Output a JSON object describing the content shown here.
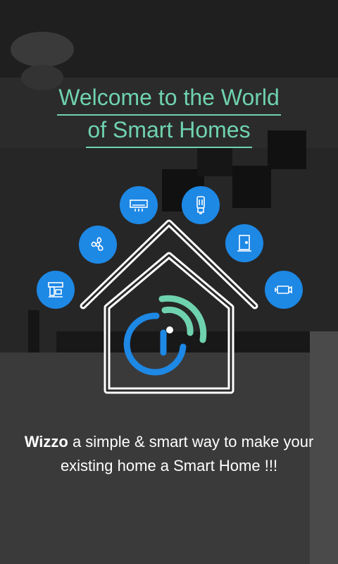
{
  "title": {
    "line1": "Welcome to the World",
    "line2": "of Smart Homes"
  },
  "tagline": {
    "brand": "Wizzo",
    "text": " a simple & smart way to make your",
    "line2": "existing home a Smart Home !!!"
  },
  "devices": [
    {
      "name": "coffee-machine-icon"
    },
    {
      "name": "fan-icon"
    },
    {
      "name": "air-conditioner-icon"
    },
    {
      "name": "light-bulb-icon"
    },
    {
      "name": "door-icon"
    },
    {
      "name": "camera-icon"
    }
  ],
  "colors": {
    "accent": "#6fd2ae",
    "icon_bg": "#1e88e5",
    "signal_green": "#6fd2ae",
    "signal_blue": "#1e88e5"
  }
}
